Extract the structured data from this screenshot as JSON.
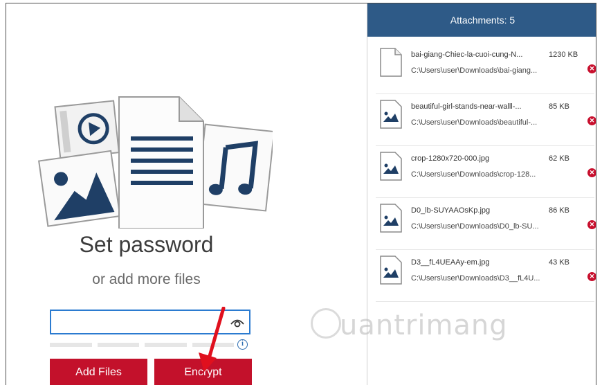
{
  "left": {
    "title": "Set password",
    "subtitle": "or add more files",
    "password": {
      "value": "",
      "placeholder": ""
    },
    "buttons": {
      "add_files": "Add Files",
      "encrypt": "Encrypt"
    },
    "info_glyph": "i"
  },
  "attachments": {
    "header": "Attachments: 5",
    "files": [
      {
        "name": "bai-giang-Chiec-la-cuoi-cung-N...",
        "path": "C:\\Users\\user\\Downloads\\bai-giang...",
        "size": "1230 KB",
        "icon": "document-icon"
      },
      {
        "name": "beautiful-girl-stands-near-walll-...",
        "path": "C:\\Users\\user\\Downloads\\beautiful-...",
        "size": "85 KB",
        "icon": "image-file-icon"
      },
      {
        "name": "crop-1280x720-000.jpg",
        "path": "C:\\Users\\user\\Downloads\\crop-128...",
        "size": "62 KB",
        "icon": "image-file-icon"
      },
      {
        "name": "D0_lb-SUYAAOsKp.jpg",
        "path": "C:\\Users\\user\\Downloads\\D0_lb-SU...",
        "size": "86 KB",
        "icon": "image-file-icon"
      },
      {
        "name": "D3__fL4UEAAy-em.jpg",
        "path": "C:\\Users\\user\\Downloads\\D3__fL4U...",
        "size": "43 KB",
        "icon": "image-file-icon"
      }
    ],
    "remove_glyph": "✕"
  },
  "watermark": {
    "text": "uantrimang"
  },
  "colors": {
    "accent_red": "#c3112b",
    "header_blue": "#2e5a87",
    "input_blue": "#2b7bd0",
    "icon_navy": "#1f3f66"
  }
}
